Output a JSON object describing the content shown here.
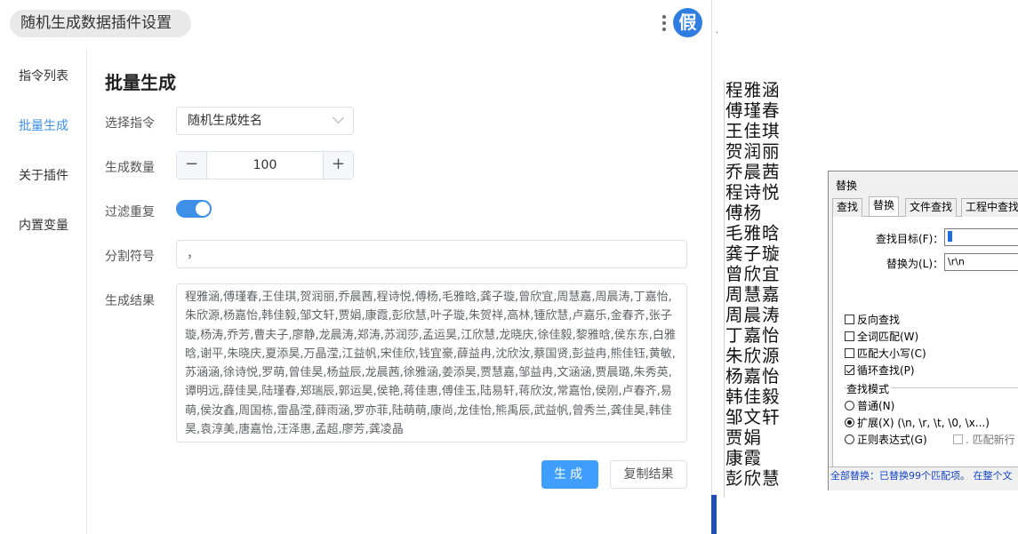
{
  "plugin": {
    "title": "随机生成数据插件设置",
    "logo": "假",
    "nav": [
      "指令列表",
      "批量生成",
      "关于插件",
      "内置变量"
    ],
    "heading": "批量生成",
    "fields": {
      "command_label": "选择指令",
      "command_value": "随机生成姓名",
      "count_label": "生成数量",
      "count_value": "100",
      "dedupe_label": "过滤重复",
      "dedupe_on": true,
      "separator_label": "分割符号",
      "separator_value": "，",
      "result_label": "生成结果",
      "result_text": "程雅涵,傅瑾春,王佳琪,贺润丽,乔晨茜,程诗悦,傅杨,毛雅晗,龚子璇,曾欣宜,周慧嘉,周晨涛,丁嘉怡,朱欣源,杨嘉怡,韩佳毅,邹文轩,贾娟,康霞,彭欣慧,叶子璇,朱贺祥,高林,锺欣慧,卢嘉乐,金春齐,张子璇,杨涛,乔芳,曹夫子,廖静,龙晨涛,郑涛,苏润莎,孟运昊,江欣慧,龙晓庆,徐佳毅,黎雅晗,侯东东,白雅晗,谢平,朱晓庆,夏添昊,万晶滢,江益帆,宋佳欣,钱宜豪,薛益冉,沈欣汝,蔡国贤,彭益冉,熊佳钰,黄敏,苏涵涵,徐诗悦,罗萌,曾佳昊,杨益辰,龙晨茜,徐雅涵,姜添昊,贾慧嘉,邹益冉,文涵涵,贾晨璐,朱秀英,谭明远,薛佳昊,陆瑾春,郑瑞辰,郭运昊,侯艳,蒋佳惠,傅佳玉,陆易轩,蒋欣汝,常嘉怡,侯刚,卢春齐,易萌,侯汝鑫,周国栋,雷晶滢,薛雨涵,罗亦菲,陆萌萌,康尚,龙佳怡,熊禹辰,武益帆,曾秀兰,龚佳昊,韩佳昊,袁淳美,唐嘉怡,汪泽惠,孟超,廖芳,龚凌晶"
    },
    "buttons": {
      "generate": "生成",
      "copy": "复制结果"
    },
    "stepper": {
      "minus": "−",
      "plus": "+"
    }
  },
  "document": {
    "names": [
      "程雅涵",
      "傅瑾春",
      "王佳琪",
      "贺润丽",
      "乔晨茜",
      "程诗悦",
      "傅杨",
      "毛雅晗",
      "龚子璇",
      "曾欣宜",
      "周慧嘉",
      "周晨涛",
      "丁嘉怡",
      "朱欣源",
      "杨嘉怡",
      "韩佳毅",
      "邹文轩",
      "贾娟",
      "康霞",
      "彭欣慧"
    ]
  },
  "dialog": {
    "title": "替换",
    "tabs": [
      "查找",
      "替换",
      "文件查找",
      "工程中查找"
    ],
    "active_tab": "替换",
    "find_label": "查找目标(F)：",
    "replace_label": "替换为(L)：",
    "replace_value": "\\r\\n",
    "options": [
      {
        "label": "反向查找",
        "checked": false
      },
      {
        "label": "全词匹配(W)",
        "checked": false
      },
      {
        "label": "匹配大小写(C)",
        "checked": false
      },
      {
        "label": "循环查找(P)",
        "checked": true
      }
    ],
    "mode_title": "查找模式",
    "modes": [
      {
        "label": "普通(N)",
        "selected": false
      },
      {
        "label": "扩展(X) (\\n, \\r, \\t, \\0, \\x...)",
        "selected": true
      },
      {
        "label": "正则表达式(G)",
        "selected": false
      }
    ],
    "dot_newline": ". 匹配新行",
    "status": "全部替换：已替换99个匹配项。 在整个文"
  }
}
